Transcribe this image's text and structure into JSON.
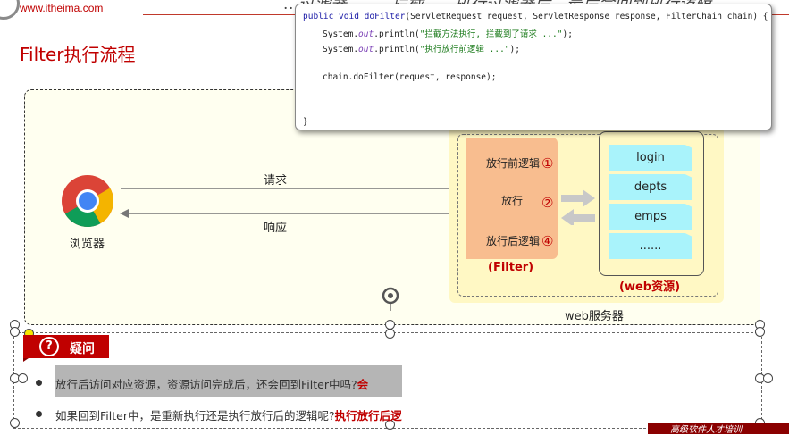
{
  "header": {
    "site_url": "www.itheima.com",
    "sub_text": "…过滤器，……拦截，…执行过滤器后，最后会回到执行逻辑。"
  },
  "slide": {
    "title": "Filter执行流程"
  },
  "code_popup": {
    "lines": [
      {
        "kw": "public void ",
        "mth": "doFilter",
        "rest": "(ServletRequest request, ServletResponse response, FilterChain chain) {"
      },
      {
        "pre": "System.",
        "ital": "out",
        "mid": ".println(",
        "str": "\"拦截方法执行, 拦截到了请求 ...\"",
        "end": ");"
      },
      {
        "pre": "System.",
        "ital": "out",
        "mid": ".println(",
        "str": "\"执行放行前逻辑 ...\"",
        "end": ");"
      },
      {
        "plain": "chain.doFilter(request, response);"
      },
      {
        "plain": "}"
      }
    ]
  },
  "diagram": {
    "browser_label": "浏览器",
    "request_label": "请求",
    "response_label": "响应",
    "filter": {
      "steps": [
        "放行前逻辑",
        "放行",
        "放行后逻辑"
      ],
      "step_numbers": [
        "①",
        "②",
        "④"
      ],
      "label": "(Filter)"
    },
    "resource_number": "③",
    "resources": [
      "login",
      "depts",
      "emps",
      "......"
    ],
    "resources_label": "(web资源)",
    "server_label": "web服务器"
  },
  "question": {
    "badge_icon": "?",
    "badge_label": "疑问",
    "items": [
      {
        "text": "放行后访问对应资源，资源访问完成后，还会回到Filter中吗?",
        "answer": "会"
      },
      {
        "text": "如果回到Filter中，是重新执行还是执行放行后的逻辑呢?",
        "answer": "执行放行后逻"
      }
    ]
  },
  "footer": {
    "text": "高级软件人才培训"
  },
  "colors": {
    "accent_red": "#c00000",
    "filter_orange": "#f8bd8f",
    "resource_cyan": "#a9f3fb",
    "server_yellow": "#fff8c4"
  }
}
